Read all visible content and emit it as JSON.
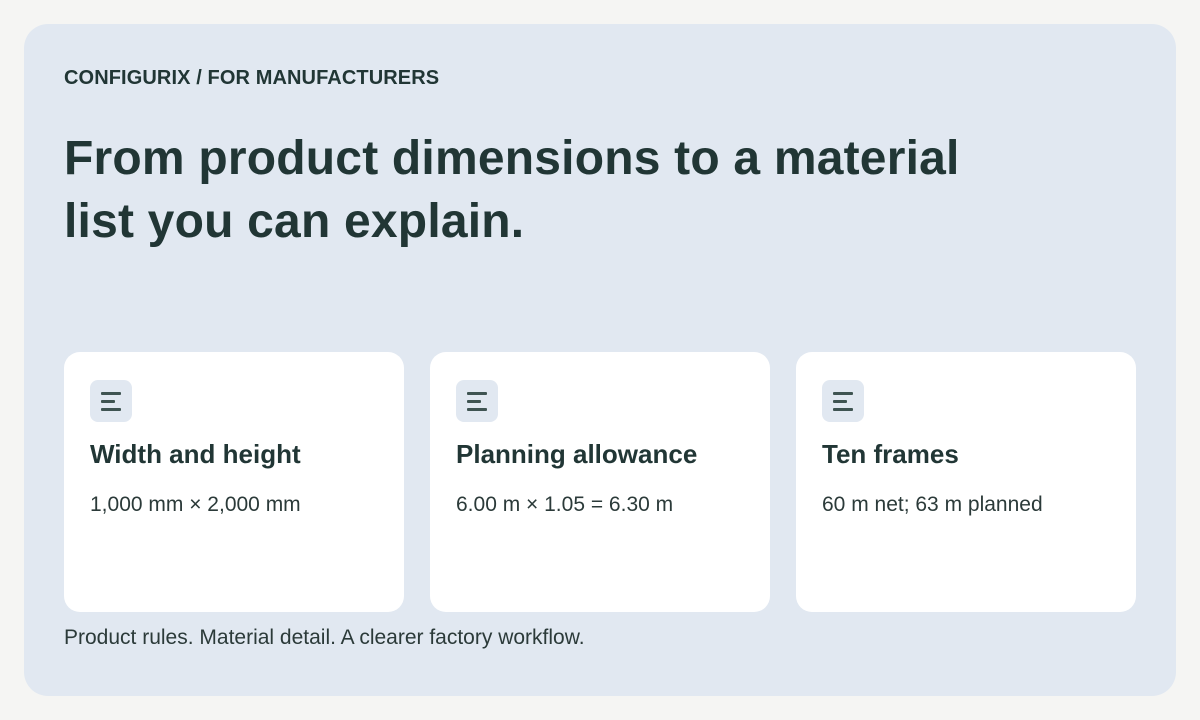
{
  "breadcrumb": "CONFIGURIX / FOR MANUFACTURERS",
  "headline": "From product dimensions to a material list you can explain.",
  "cards": [
    {
      "icon": "list-icon",
      "title": "Width and height",
      "value": "1,000 mm × 2,000 mm"
    },
    {
      "icon": "list-icon",
      "title": "Planning allowance",
      "value": "6.00 m × 1.05 = 6.30 m"
    },
    {
      "icon": "list-icon",
      "title": "Ten frames",
      "value": "60 m net; 63 m planned"
    }
  ],
  "footer": "Product rules. Material detail. A clearer factory workflow.",
  "colors": {
    "page_background": "#f5f5f3",
    "panel_background": "#e1e8f1",
    "card_background": "#ffffff",
    "text_primary": "#213635",
    "icon_stroke": "#3f5452"
  }
}
